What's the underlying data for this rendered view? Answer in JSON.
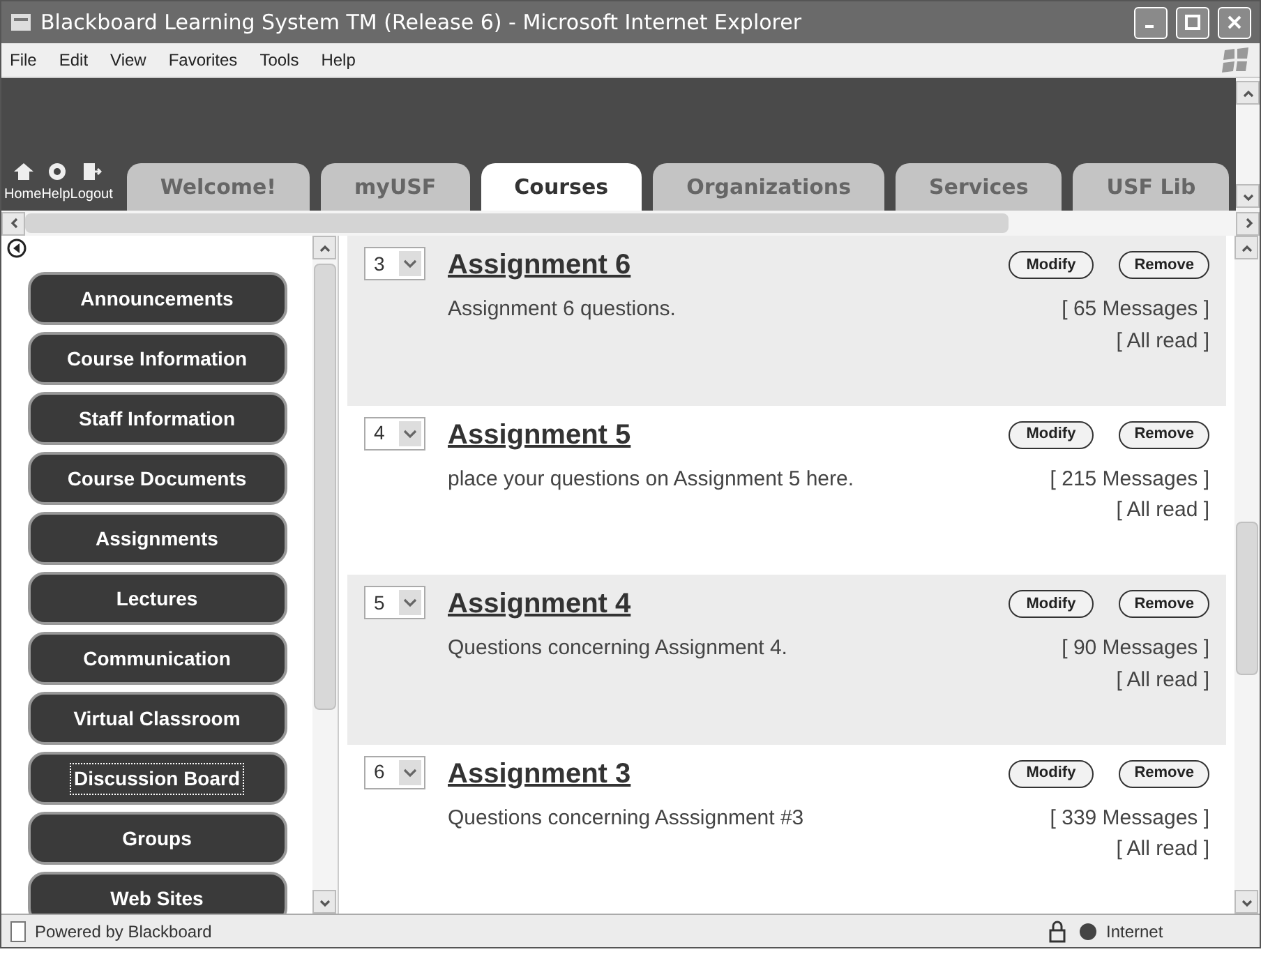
{
  "window": {
    "title": "Blackboard Learning System TM (Release 6) - Microsoft Internet Explorer"
  },
  "menu": [
    "File",
    "Edit",
    "View",
    "Favorites",
    "Tools",
    "Help"
  ],
  "header_links": [
    {
      "label": "Home"
    },
    {
      "label": "Help"
    },
    {
      "label": "Logout"
    }
  ],
  "tabs": [
    {
      "label": "Welcome!",
      "selected": false
    },
    {
      "label": "myUSF",
      "selected": false
    },
    {
      "label": "Courses",
      "selected": true
    },
    {
      "label": "Organizations",
      "selected": false
    },
    {
      "label": "Services",
      "selected": false
    },
    {
      "label": "USF Lib",
      "selected": false
    }
  ],
  "sidebar": {
    "items": [
      {
        "label": "Announcements",
        "focused": false
      },
      {
        "label": "Course Information",
        "focused": false
      },
      {
        "label": "Staff Information",
        "focused": false
      },
      {
        "label": "Course Documents",
        "focused": false
      },
      {
        "label": "Assignments",
        "focused": false
      },
      {
        "label": "Lectures",
        "focused": false
      },
      {
        "label": "Communication",
        "focused": false
      },
      {
        "label": "Virtual Classroom",
        "focused": false
      },
      {
        "label": "Discussion Board",
        "focused": true
      },
      {
        "label": "Groups",
        "focused": false
      },
      {
        "label": "Web Sites",
        "focused": false
      }
    ]
  },
  "forums": [
    {
      "order": "3",
      "title": "Assignment 6",
      "description": "Assignment 6 questions.",
      "messages": "[ 65 Messages ]",
      "read": "[ All read ]",
      "shaded": true,
      "modify": "Modify",
      "remove": "Remove"
    },
    {
      "order": "4",
      "title": "Assignment 5",
      "description": "place your questions on Assignment 5 here.",
      "messages": "[ 215 Messages ]",
      "read": "[ All read ]",
      "shaded": false,
      "modify": "Modify",
      "remove": "Remove"
    },
    {
      "order": "5",
      "title": "Assignment 4",
      "description": "Questions concerning Assignment 4.",
      "messages": "[ 90 Messages ]",
      "read": "[ All read ]",
      "shaded": true,
      "modify": "Modify",
      "remove": "Remove"
    },
    {
      "order": "6",
      "title": "Assignment 3",
      "description": "Questions concerning Asssignment #3",
      "messages": "[ 339 Messages ]",
      "read": "[ All read ]",
      "shaded": false,
      "modify": "Modify",
      "remove": "Remove"
    }
  ],
  "status_bar": {
    "text": "Powered by Blackboard",
    "zone": "Internet"
  }
}
